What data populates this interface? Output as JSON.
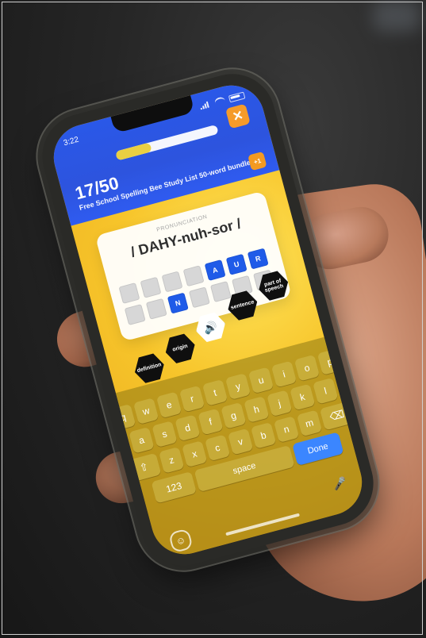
{
  "status": {
    "time": "3:22"
  },
  "header": {
    "progress_text": "17/50",
    "progress_fraction": 0.34,
    "bundle_title": "Free School Spelling Bee Study List 50-word bundle",
    "close_symbol": "✕",
    "badge_text": "+1"
  },
  "card": {
    "label": "PRONUNCIATION",
    "pronunciation": "/ DAHY-nuh-sor /",
    "tiles": {
      "row1": [
        "",
        "",
        "",
        "",
        "A",
        "U",
        "R"
      ],
      "row2": [
        "",
        "",
        "N",
        "",
        "",
        "",
        ""
      ]
    }
  },
  "options": {
    "definition": "definition",
    "origin": "origin",
    "audio_icon": "speaker-icon",
    "sentence": "sentence",
    "part_of_speech": "part of speech"
  },
  "keyboard": {
    "row1": [
      "q",
      "w",
      "e",
      "r",
      "t",
      "y",
      "u",
      "i",
      "o",
      "p"
    ],
    "row2": [
      "a",
      "s",
      "d",
      "f",
      "g",
      "h",
      "j",
      "k",
      "l"
    ],
    "row3": [
      "z",
      "x",
      "c",
      "v",
      "b",
      "n",
      "m"
    ],
    "space_label": "space",
    "done_label": "Done",
    "num_label": "123",
    "emoji_symbol": "☺",
    "mic_symbol": "🎤",
    "shift_symbol": "⇧",
    "delete_symbol": "⌫"
  },
  "colors": {
    "brand_blue": "#2a58e8",
    "accent_orange": "#f59b2a",
    "yellow_bg": "#f7c52b",
    "done_blue": "#3b86ff"
  }
}
